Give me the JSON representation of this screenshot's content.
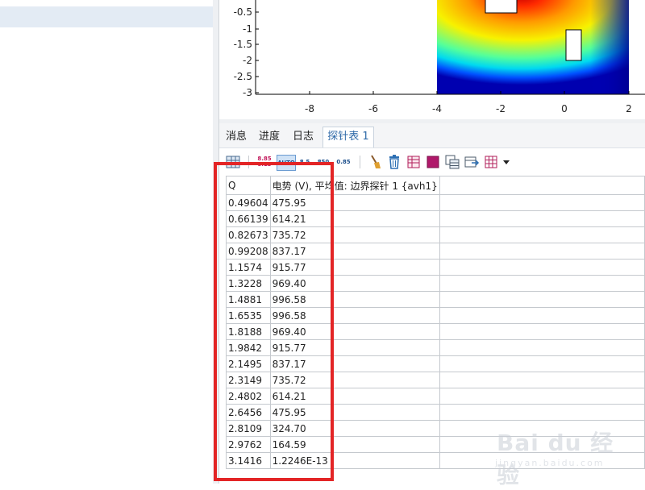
{
  "plot": {
    "x_ticks": [
      "-8",
      "-6",
      "-4",
      "-2",
      "0",
      "2"
    ],
    "y_ticks": [
      "-0.5",
      "-1",
      "-1.5",
      "-2",
      "-2.5",
      "-3"
    ]
  },
  "tabs": [
    {
      "label": "消息",
      "active": false
    },
    {
      "label": "进度",
      "active": false
    },
    {
      "label": "日志",
      "active": false
    },
    {
      "label": "探针表 1",
      "active": true
    }
  ],
  "toolbar": {
    "fmt_a_top": "8.85",
    "fmt_a_bottom": "8.13",
    "auto_label": "AUTO",
    "fmt_b": "8.5",
    "fmt_c": "850",
    "fmt_d": "0.85"
  },
  "table": {
    "headers": [
      "Q",
      "电势 (V), 平均值: 边界探针 1 {avh1}"
    ],
    "rows": [
      [
        "0.49604",
        "475.95"
      ],
      [
        "0.66139",
        "614.21"
      ],
      [
        "0.82673",
        "735.72"
      ],
      [
        "0.99208",
        "837.17"
      ],
      [
        "1.1574",
        "915.77"
      ],
      [
        "1.3228",
        "969.40"
      ],
      [
        "1.4881",
        "996.58"
      ],
      [
        "1.6535",
        "996.58"
      ],
      [
        "1.8188",
        "969.40"
      ],
      [
        "1.9842",
        "915.77"
      ],
      [
        "2.1495",
        "837.17"
      ],
      [
        "2.3149",
        "735.72"
      ],
      [
        "2.4802",
        "614.21"
      ],
      [
        "2.6456",
        "475.95"
      ],
      [
        "2.8109",
        "324.70"
      ],
      [
        "2.9762",
        "164.59"
      ],
      [
        "3.1416",
        "1.2246E-13"
      ]
    ]
  },
  "watermark": {
    "brand": "Bai du 经验",
    "url": "jingyan.baidu.com"
  },
  "colors": {
    "highlight": "#e32526",
    "active_tab": "#2f6aa8",
    "selection": "#e3ebf4"
  }
}
